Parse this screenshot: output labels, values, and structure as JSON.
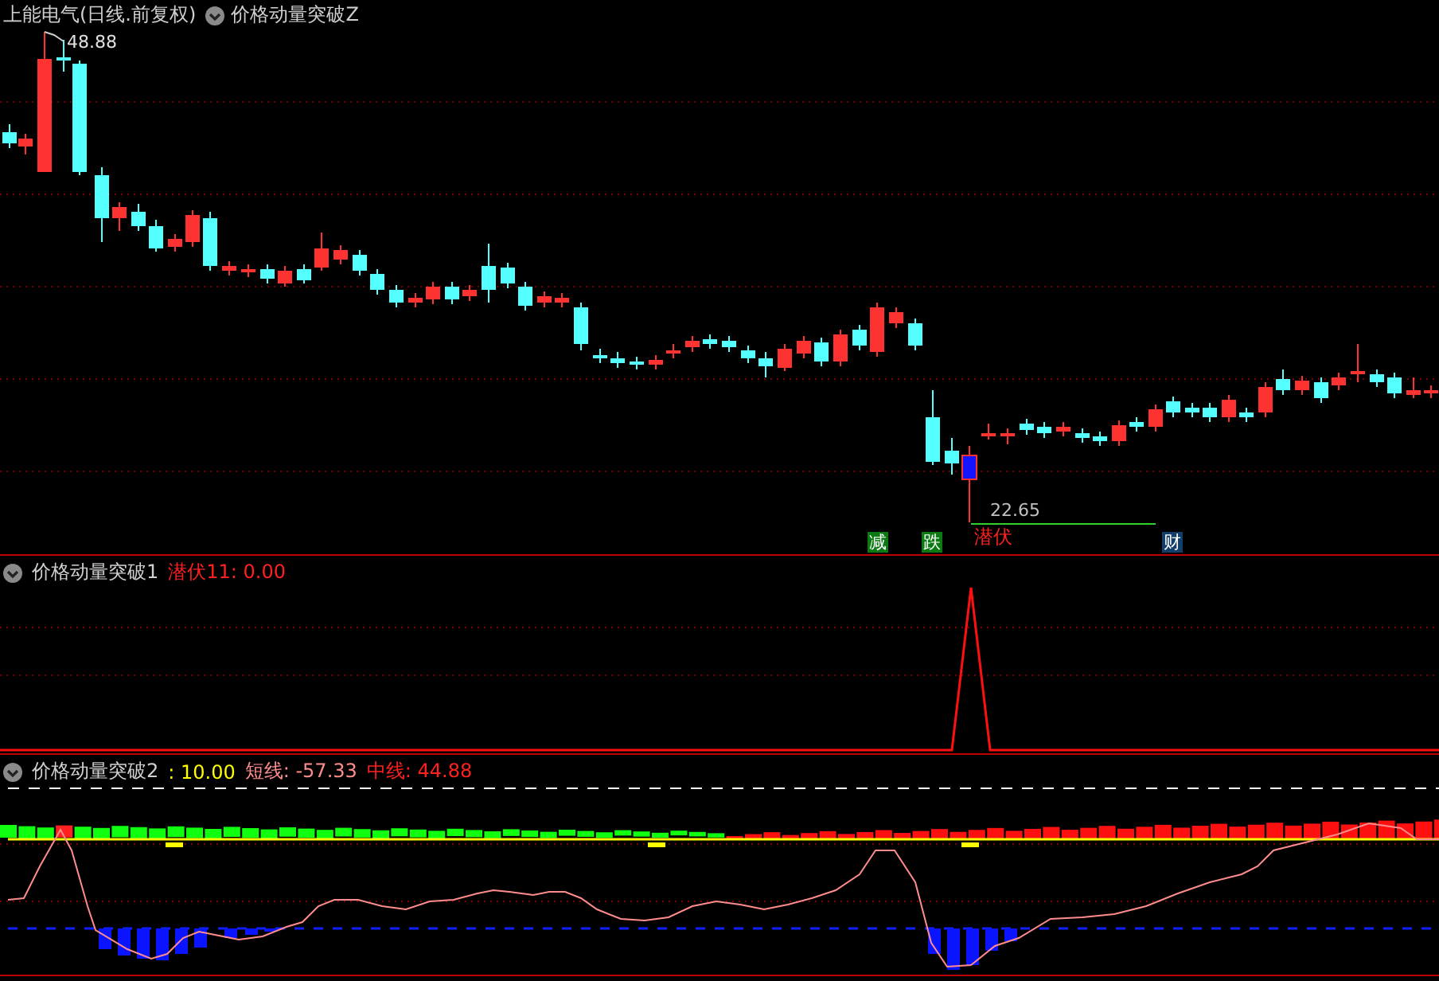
{
  "chart_header": {
    "title": "上能电气(日线.前复权)",
    "indicator": "价格动量突破Z"
  },
  "price_panel": {
    "high_label": "48.88",
    "low_label": "22.65",
    "signal_label": "潜伏",
    "event_badges": [
      {
        "text": "减",
        "color": "#0b7a12"
      },
      {
        "text": "跌",
        "color": "#0b7a12"
      },
      {
        "text": "财",
        "color": "#143e6a"
      }
    ]
  },
  "indicator_1": {
    "name": "价格动量突破1",
    "readings": [
      {
        "label": "潜伏11: 0.00",
        "color": "#ff2020"
      }
    ]
  },
  "indicator_2": {
    "name": "价格动量突破2",
    "readings": [
      {
        "label": ": 10.00",
        "color": "#ffff00"
      },
      {
        "label": "短线: -57.33",
        "color": "#ff8c8c"
      },
      {
        "label": "中线: 44.88",
        "color": "#ff2020"
      }
    ]
  }
}
